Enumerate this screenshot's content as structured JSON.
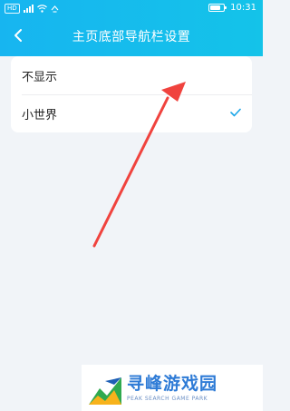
{
  "status_bar": {
    "time": "10:31",
    "hd_badge": "HD"
  },
  "header": {
    "title": "主页底部导航栏设置",
    "back_icon": "chevron-left-icon"
  },
  "options": [
    {
      "label": "不显示",
      "selected": false
    },
    {
      "label": "小世界",
      "selected": true
    }
  ],
  "colors": {
    "header": "#17b5f0",
    "check": "#1ba6e8",
    "arrow": "#f0433e",
    "background": "#f1f4f8"
  },
  "watermark": {
    "title": "寻峰游戏园",
    "subtitle": "PEAK SEARCH GAME PARK"
  }
}
